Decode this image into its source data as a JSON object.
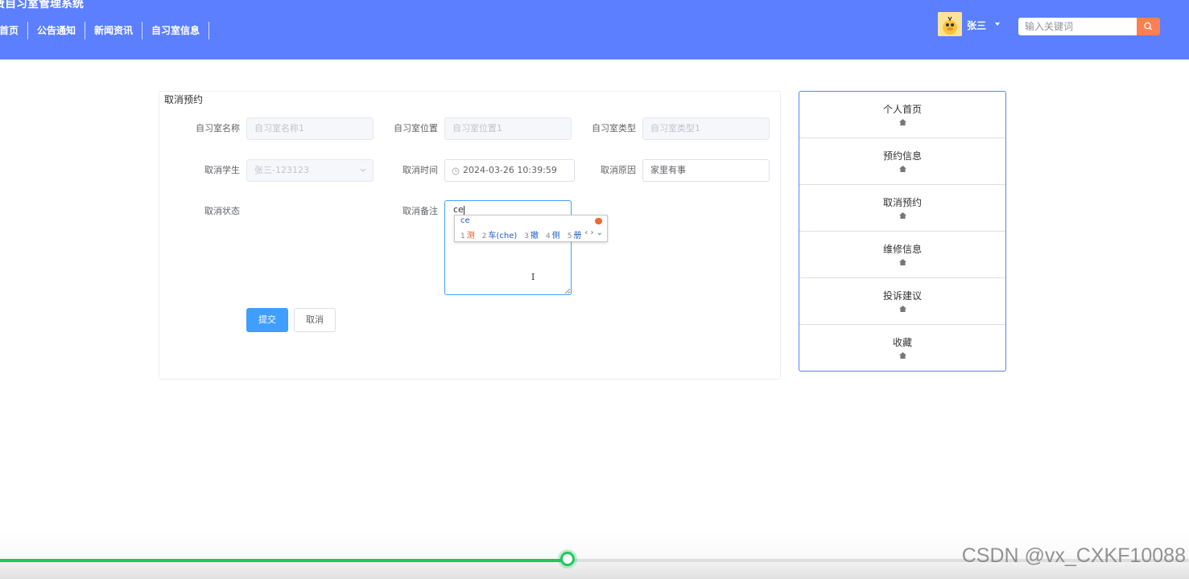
{
  "header": {
    "site_title": "付费自习室管理系统",
    "nav": [
      "首页",
      "公告通知",
      "新闻资讯",
      "自习室信息"
    ],
    "user_name": "张三",
    "search_placeholder": "输入关键词"
  },
  "form": {
    "title": "取消预约",
    "fields": {
      "room_name": {
        "label": "自习室名称",
        "placeholder": "自习室名称1"
      },
      "room_location": {
        "label": "自习室位置",
        "placeholder": "自习室位置1"
      },
      "room_type": {
        "label": "自习室类型",
        "placeholder": "自习室类型1"
      },
      "student": {
        "label": "取消学生",
        "value": "张三-123123"
      },
      "cancel_time": {
        "label": "取消时间",
        "value": "2024-03-26 10:39:59"
      },
      "cancel_reason": {
        "label": "取消原因",
        "value": "家里有事"
      },
      "status": {
        "label": "取消状态"
      },
      "remark": {
        "label": "取消备注",
        "value": "ce"
      }
    },
    "submit_label": "提交",
    "cancel_label": "取消"
  },
  "ime": {
    "code": "ce",
    "candidates": [
      {
        "n": "1",
        "text": "测"
      },
      {
        "n": "2",
        "text": "车(che)"
      },
      {
        "n": "3",
        "text": "撤"
      },
      {
        "n": "4",
        "text": "侧"
      },
      {
        "n": "5",
        "text": "册"
      }
    ],
    "nav_glyphs": "‹ › ⌄"
  },
  "side_menu": [
    "个人首页",
    "预约信息",
    "取消预约",
    "维修信息",
    "投诉建议",
    "收藏"
  ],
  "video": {
    "progress_fraction": 0.477,
    "accent": "#1ec760"
  },
  "watermark": "CSDN @vx_CXKF10088",
  "colors": {
    "header_bg": "#5b7fff",
    "primary": "#409eff",
    "search_btn": "#ff7f50"
  }
}
